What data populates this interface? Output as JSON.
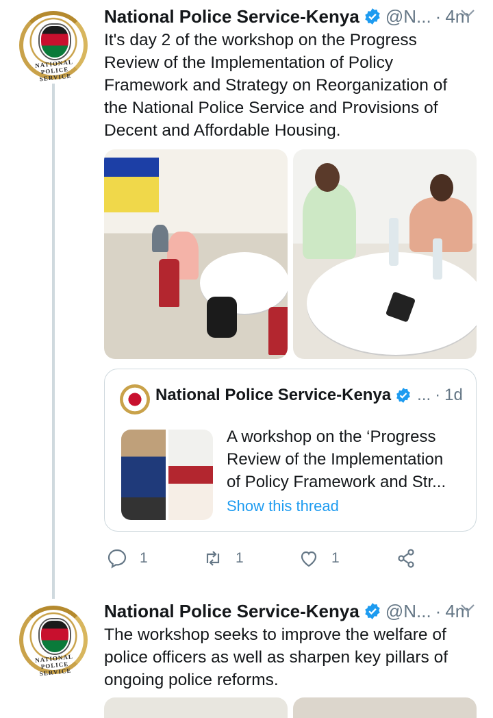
{
  "tweets": [
    {
      "avatar_text": "NATIONAL POLICE SERVICE",
      "name": "National Police Service-Kenya",
      "handle": "@N...",
      "dot": "·",
      "time": "4m",
      "text": "It's day 2 of the workshop on the Progress Review of the Implementation of Policy Framework and Strategy on Reorganization of the National Police Service and Provisions of Decent and Affordable Housing.",
      "quote": {
        "name": "National Police Service-Kenya",
        "handle": "...",
        "dot": "·",
        "time": "1d",
        "text": "A workshop on the ‘Progress Review of the Implementation of Policy Framework and Str...",
        "link": "Show this thread"
      },
      "actions": {
        "reply_count": "1",
        "retweet_count": "1",
        "like_count": "1"
      }
    },
    {
      "avatar_text": "NATIONAL POLICE SERVICE",
      "name": "National Police Service-Kenya",
      "handle": "@N...",
      "dot": "·",
      "time": "4m",
      "text": "The workshop seeks to improve the welfare of police officers as well as sharpen key pillars of ongoing police reforms."
    }
  ],
  "colors": {
    "text": "#14171a",
    "secondary": "#657786",
    "link": "#1d9bf0",
    "verified": "#1d9bf0",
    "border": "#cfd9de"
  },
  "icons": {
    "reply": "reply-icon",
    "retweet": "retweet-icon",
    "like": "heart-icon",
    "share": "share-icon",
    "more": "chevron-down-icon",
    "verified": "verified-badge-icon"
  }
}
